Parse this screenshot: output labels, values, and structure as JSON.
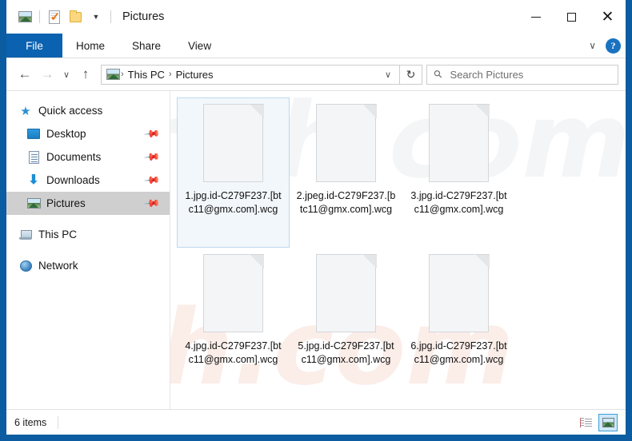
{
  "window": {
    "title": "Pictures",
    "quick_access_toolbar": [
      {
        "name": "picture-properties-icon",
        "label": "Picture tools"
      },
      {
        "name": "properties-icon",
        "label": "Properties"
      },
      {
        "name": "new-folder-icon",
        "label": "New folder"
      },
      {
        "name": "customize-caret-icon",
        "label": "▾"
      }
    ],
    "controls": {
      "minimize": "—",
      "maximize": "□",
      "close": "✕"
    }
  },
  "ribbon": {
    "tabs": [
      {
        "label": "File",
        "active": true
      },
      {
        "label": "Home",
        "active": false
      },
      {
        "label": "Share",
        "active": false
      },
      {
        "label": "View",
        "active": false
      }
    ],
    "collapse_caret": "∨",
    "help_label": "?"
  },
  "navigation": {
    "back": "←",
    "forward": "→",
    "recent_caret": "∨",
    "up": "↑",
    "breadcrumbs": [
      "This PC",
      "Pictures"
    ],
    "breadcrumb_separator": "›",
    "address_caret": "∨",
    "refresh": "↻"
  },
  "search": {
    "placeholder": "Search Pictures",
    "value": "",
    "icon": "search-icon"
  },
  "sidebar": {
    "items": [
      {
        "label": "Quick access",
        "icon": "star-icon",
        "root": true,
        "pinned": false,
        "selected": false
      },
      {
        "label": "Desktop",
        "icon": "desktop-icon",
        "root": false,
        "pinned": true,
        "selected": false
      },
      {
        "label": "Documents",
        "icon": "documents-icon",
        "root": false,
        "pinned": true,
        "selected": false
      },
      {
        "label": "Downloads",
        "icon": "downloads-icon",
        "root": false,
        "pinned": true,
        "selected": false
      },
      {
        "label": "Pictures",
        "icon": "pictures-icon",
        "root": false,
        "pinned": true,
        "selected": true
      },
      {
        "label": "This PC",
        "icon": "this-pc-icon",
        "root": true,
        "pinned": false,
        "selected": false
      },
      {
        "label": "Network",
        "icon": "network-icon",
        "root": true,
        "pinned": false,
        "selected": false
      }
    ],
    "pin_glyph": "📌"
  },
  "files": [
    {
      "name": "1.jpg.id-C279F237.[btc11@gmx.com].wcg",
      "selected": true
    },
    {
      "name": "2.jpeg.id-C279F237.[btc11@gmx.com].wcg",
      "selected": false
    },
    {
      "name": "3.jpg.id-C279F237.[btc11@gmx.com].wcg",
      "selected": false
    },
    {
      "name": "4.jpg.id-C279F237.[btc11@gmx.com].wcg",
      "selected": false
    },
    {
      "name": "5.jpg.id-C279F237.[btc11@gmx.com].wcg",
      "selected": false
    },
    {
      "name": "6.jpg.id-C279F237.[btc11@gmx.com].wcg",
      "selected": false
    }
  ],
  "statusbar": {
    "item_count": "6 items",
    "views": [
      {
        "name": "details-view",
        "active": false
      },
      {
        "name": "large-icons-view",
        "active": true
      }
    ]
  },
  "watermark": {
    "top": "rish.com",
    "bottom": "rish.com"
  },
  "colors": {
    "window_border": "#0b5ca0",
    "ribbon_accent": "#0b62b0",
    "selection_fill": "#f2f7fb",
    "selection_border": "#bcd8ef",
    "sidebar_selected": "#cfcfcf"
  }
}
